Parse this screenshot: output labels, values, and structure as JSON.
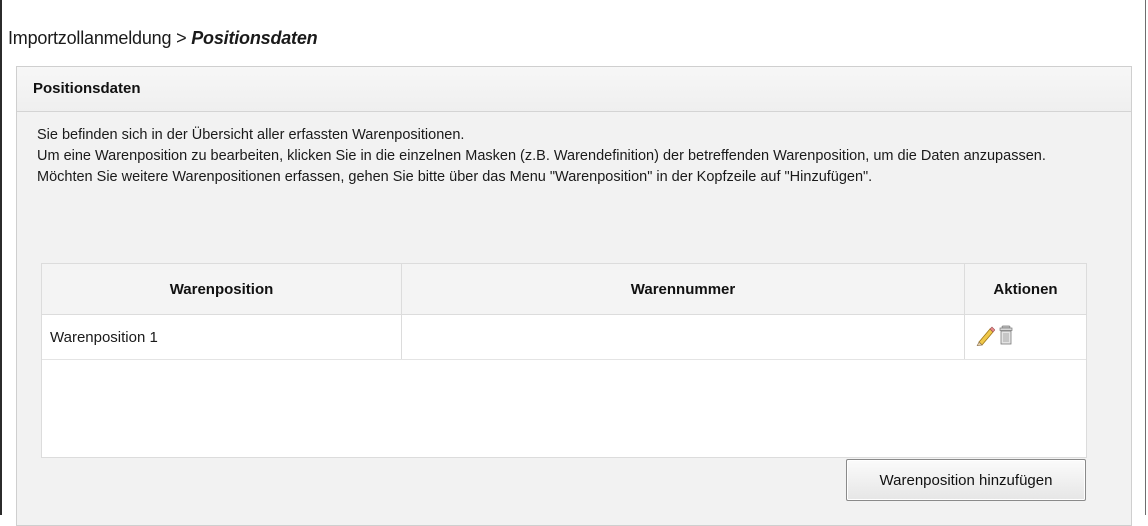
{
  "breadcrumb": {
    "parent": "Importzollanmeldung",
    "separator": ">",
    "current": "Positionsdaten"
  },
  "panel": {
    "title": "Positionsdaten",
    "intro": [
      "Sie befinden sich in der Übersicht aller erfassten Warenpositionen.",
      "Um eine Warenposition zu bearbeiten, klicken Sie in die einzelnen Masken (z.B. Warendefinition) der betreffenden Warenposition, um die Daten anzupassen.",
      "Möchten Sie weitere Warenpositionen erfassen, gehen Sie bitte über das Menu \"Warenposition\" in der Kopfzeile auf \"Hinzufügen\"."
    ]
  },
  "table": {
    "columns": [
      "Warenposition",
      "Warennummer",
      "Aktionen"
    ],
    "rows": [
      {
        "warenposition": "Warenposition 1",
        "warennummer": "",
        "actions": [
          "pencil-icon",
          "trash-icon"
        ]
      }
    ]
  },
  "buttons": {
    "add_label": "Warenposition hinzufügen"
  },
  "colors": {
    "panel_bg": "#f2f2f2",
    "table_header_bg": "#f4f4f4",
    "border": "#dcdcdc"
  }
}
